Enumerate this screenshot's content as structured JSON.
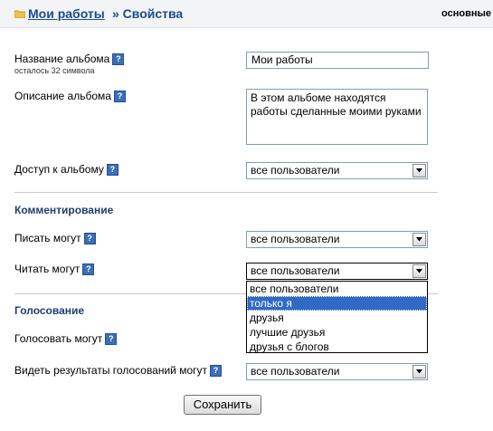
{
  "header": {
    "breadcrumb_link": "Мои работы",
    "breadcrumb_current": "» Свойства",
    "tab_label": "основные"
  },
  "help_icon": "?",
  "album": {
    "name_label": "Название альбома",
    "name_hint": "осталось 32 символа",
    "name_value": "Мои работы",
    "description_label": "Описание альбома",
    "description_value": "В этом альбоме находятся\nработы сделанные моими руками",
    "access_label": "Доступ к альбому",
    "access_value": "все пользователи"
  },
  "comments": {
    "title": "Комментирование",
    "write_label": "Писать могут",
    "write_value": "все пользователи",
    "read_label": "Читать могут",
    "read_value": "все пользователи",
    "options": [
      {
        "label": "все пользователи",
        "selected": false
      },
      {
        "label": "только я",
        "selected": true
      },
      {
        "label": "друзья",
        "selected": false
      },
      {
        "label": "лучшие друзья",
        "selected": false
      },
      {
        "label": "друзья с блогов",
        "selected": false
      }
    ]
  },
  "voting": {
    "title": "Голосование",
    "vote_label": "Голосовать могут",
    "results_label": "Видеть результаты голосований могут",
    "results_value": "все пользователи"
  },
  "save_label": "Сохранить",
  "colors": {
    "link": "#1e4a8a",
    "section_title": "#1e3f6d",
    "help_icon": "#3c6fb4",
    "highlight": "#316ac5",
    "folder": "#f0c24a"
  }
}
